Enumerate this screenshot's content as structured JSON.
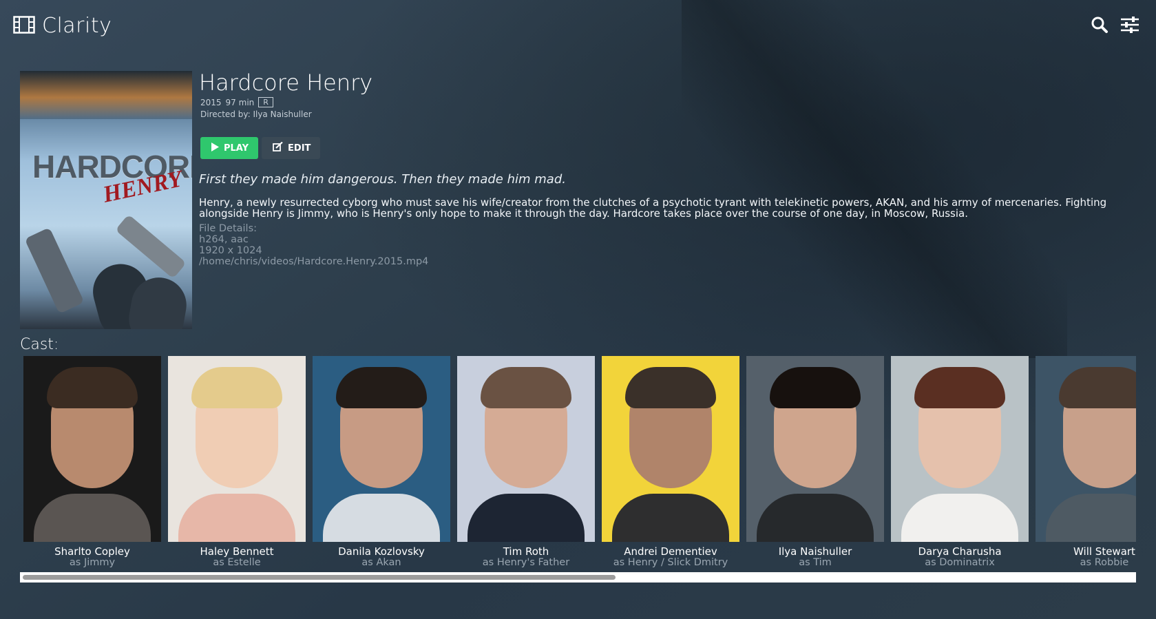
{
  "app": {
    "name": "Clarity"
  },
  "header": {
    "icons": [
      "film-icon",
      "search-icon",
      "sliders-icon"
    ]
  },
  "movie": {
    "title": "Hardcore Henry",
    "year": "2015",
    "runtime": "97 min",
    "rating": "R",
    "director": "Directed by: Ilya Naishuller",
    "poster": {
      "title_text": "HARDCORE",
      "subtitle_text": "HENRY"
    },
    "tagline": "First they made him dangerous. Then they made him mad.",
    "overview": "Henry, a newly resurrected cyborg who must save his wife/creator from the clutches of a psychotic tyrant with telekinetic powers, AKAN, and his army of mercenaries. Fighting alongside Henry is Jimmy, who is Henry's only hope to make it through the day. Hardcore takes place over the course of one day, in Moscow, Russia.",
    "file": {
      "label": "File Details:",
      "codecs": "h264, aac",
      "resolution": "1920 x 1024",
      "path": "/home/chris/videos/Hardcore.Henry.2015.mp4"
    }
  },
  "actions": {
    "play_label": "PLAY",
    "edit_label": "EDIT"
  },
  "cast": {
    "label": "Cast:",
    "members": [
      {
        "name": "Sharlto Copley",
        "role": "as Jimmy",
        "bg": "#1a1a1a",
        "skin": "#b88a6e",
        "hair": "#3b2c22",
        "shirt": "#5a5552"
      },
      {
        "name": "Haley Bennett",
        "role": "as Estelle",
        "bg": "#e9e4de",
        "skin": "#f0cdb4",
        "hair": "#e4cb8c",
        "shirt": "#e7b7a8"
      },
      {
        "name": "Danila Kozlovsky",
        "role": "as Akan",
        "bg": "#2b5d82",
        "skin": "#c79b84",
        "hair": "#231c18",
        "shirt": "#d6dce2"
      },
      {
        "name": "Tim Roth",
        "role": "as Henry's Father",
        "bg": "#c8cfdd",
        "skin": "#d5ab95",
        "hair": "#6a5243",
        "shirt": "#1d2533"
      },
      {
        "name": "Andrei Dementiev",
        "role": "as Henry / Slick Dmitry",
        "bg": "#f2d43a",
        "skin": "#b0846a",
        "hair": "#3a3029",
        "shirt": "#2e2e2f"
      },
      {
        "name": "Ilya Naishuller",
        "role": "as Tim",
        "bg": "#55606a",
        "skin": "#cfa58d",
        "hair": "#17110e",
        "shirt": "#26292c"
      },
      {
        "name": "Darya Charusha",
        "role": "as Dominatrix",
        "bg": "#b9c2c6",
        "skin": "#e5c1ac",
        "hair": "#5a2f22",
        "shirt": "#f1f0ee"
      },
      {
        "name": "Will Stewart",
        "role": "as Robbie",
        "bg": "#3d5466",
        "skin": "#c8a08a",
        "hair": "#4a3a30",
        "shirt": "#4e5a63"
      }
    ]
  },
  "scroll": {
    "thumb_fraction": 0.534
  }
}
